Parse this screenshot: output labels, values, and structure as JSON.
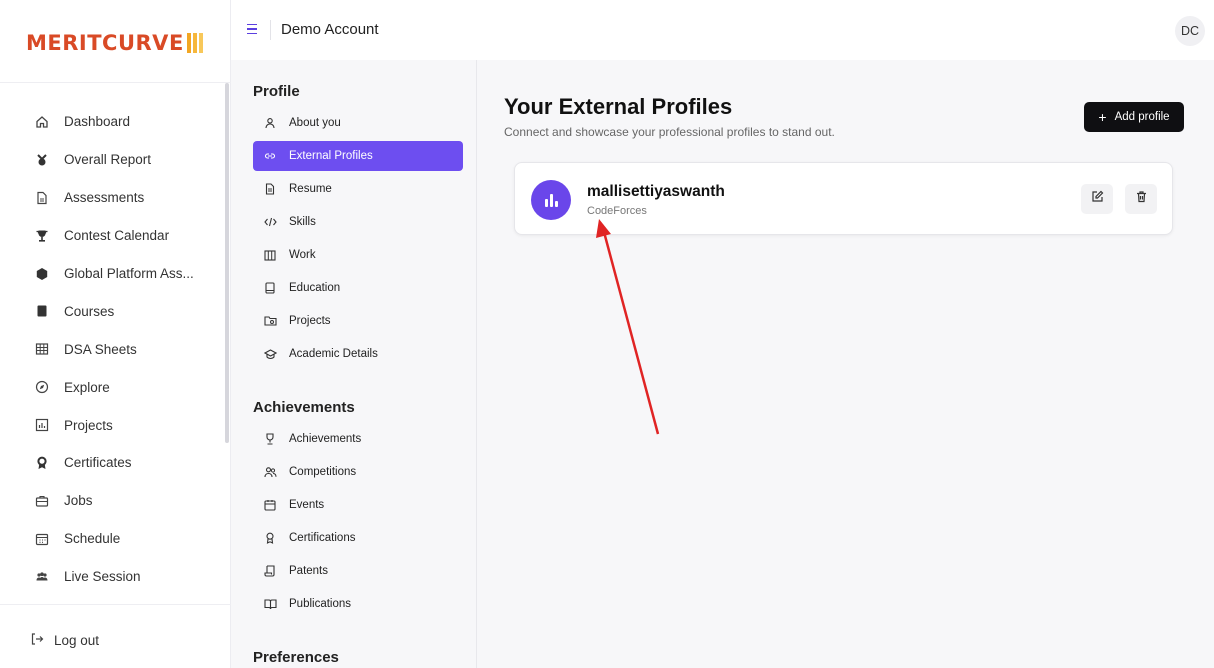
{
  "brand": {
    "logo_text": "MERITCURVE"
  },
  "topbar": {
    "account_title": "Demo Account",
    "avatar_initials": "DC"
  },
  "sidebar": {
    "items": [
      {
        "label": "Dashboard",
        "icon": "home-icon"
      },
      {
        "label": "Overall Report",
        "icon": "report-icon"
      },
      {
        "label": "Assessments",
        "icon": "document-icon"
      },
      {
        "label": "Contest Calendar",
        "icon": "trophy-icon"
      },
      {
        "label": "Global Platform Ass...",
        "icon": "hexagon-icon"
      },
      {
        "label": "Courses",
        "icon": "book-icon"
      },
      {
        "label": "DSA Sheets",
        "icon": "grid-icon"
      },
      {
        "label": "Explore",
        "icon": "compass-icon"
      },
      {
        "label": "Projects",
        "icon": "chart-icon"
      },
      {
        "label": "Certificates",
        "icon": "badge-icon"
      },
      {
        "label": "Jobs",
        "icon": "briefcase-icon"
      },
      {
        "label": "Schedule",
        "icon": "calendar-icon"
      },
      {
        "label": "Live Session",
        "icon": "people-icon"
      }
    ],
    "logout_label": "Log out"
  },
  "subnav": {
    "profile_title": "Profile",
    "profile_items": [
      {
        "label": "About you",
        "icon": "user-icon"
      },
      {
        "label": "External Profiles",
        "icon": "link-icon",
        "active": true
      },
      {
        "label": "Resume",
        "icon": "file-icon"
      },
      {
        "label": "Skills",
        "icon": "code-icon"
      },
      {
        "label": "Work",
        "icon": "building-icon"
      },
      {
        "label": "Education",
        "icon": "book-icon"
      },
      {
        "label": "Projects",
        "icon": "folder-icon"
      },
      {
        "label": "Academic Details",
        "icon": "graduation-cap-icon"
      }
    ],
    "achievements_title": "Achievements",
    "achievements_items": [
      {
        "label": "Achievements",
        "icon": "trophy-icon"
      },
      {
        "label": "Competitions",
        "icon": "users-icon"
      },
      {
        "label": "Events",
        "icon": "calendar-icon"
      },
      {
        "label": "Certifications",
        "icon": "ribbon-icon"
      },
      {
        "label": "Patents",
        "icon": "scroll-icon"
      },
      {
        "label": "Publications",
        "icon": "open-book-icon"
      }
    ],
    "preferences_title": "Preferences"
  },
  "main": {
    "title": "Your External Profiles",
    "subtitle": "Connect and showcase your professional profiles to stand out.",
    "add_button_label": "Add profile",
    "profiles": [
      {
        "username": "mallisettiyaswanth",
        "platform": "CodeForces",
        "icon": "bar-chart-icon"
      }
    ]
  },
  "colors": {
    "accent": "#6d4ef0",
    "brand": "#d94a26",
    "annotation_arrow": "#e02424"
  }
}
